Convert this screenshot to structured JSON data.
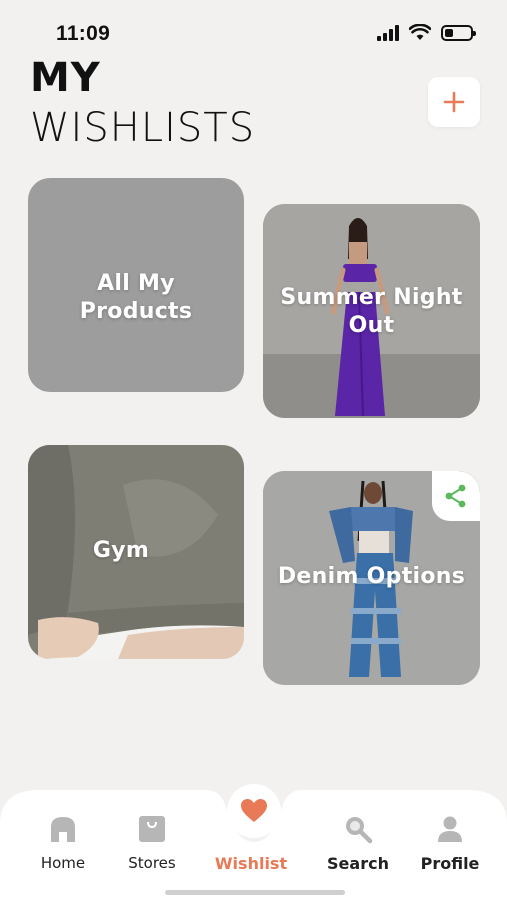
{
  "status": {
    "time": "11:09"
  },
  "header": {
    "title_line1": "MY",
    "title_line2": "WISHLISTS",
    "add_icon": "plus-icon"
  },
  "accent_color": "#e97a57",
  "wishlists": [
    {
      "name": "All My Products"
    },
    {
      "name": "Summer Night Out"
    },
    {
      "name": "Gym"
    },
    {
      "name": "Denim Options",
      "share_icon": "share-icon"
    }
  ],
  "nav": {
    "items": [
      {
        "label": "Home",
        "icon": "home-icon"
      },
      {
        "label": "Stores",
        "icon": "bag-icon"
      },
      {
        "label": "Wishlist",
        "icon": "heart-icon",
        "active": true
      },
      {
        "label": "Search",
        "icon": "search-icon"
      },
      {
        "label": "Profile",
        "icon": "profile-icon"
      }
    ]
  }
}
